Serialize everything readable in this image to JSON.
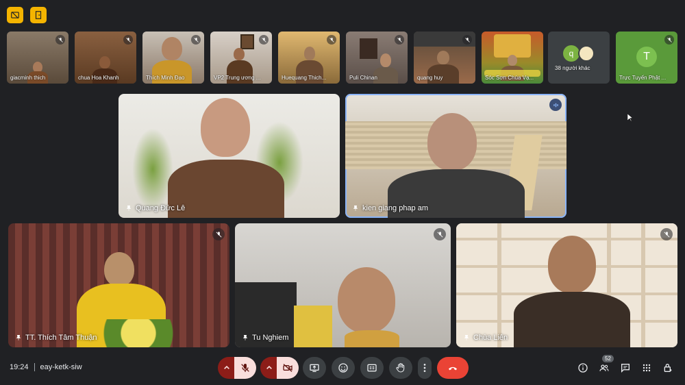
{
  "meeting": {
    "time": "19:24",
    "code": "eay-ketk-siw"
  },
  "thumbnails": [
    {
      "name": "giacminh thich",
      "bg": "#6b5a48"
    },
    {
      "name": "chua Hoa Khanh",
      "bg": "#7a4a2c"
    },
    {
      "name": "Thích Minh Đạo",
      "bg": "#8c7a6a"
    },
    {
      "name": "VP2 Trung ương ...",
      "bg": "#b4aaa0"
    },
    {
      "name": "Huequang Thich...",
      "bg": "#c49a5c"
    },
    {
      "name": "Puli Chinan",
      "bg": "#7a6c66"
    },
    {
      "name": "quang huy",
      "bg": "#9a6a4a"
    },
    {
      "name": "Sóc Sơn Chùa Vạ...",
      "bg": "#9a8a2a"
    }
  ],
  "others": {
    "label": "38 người khác",
    "initial": "q"
  },
  "livestream": {
    "name": "Trực Tuyến Phật ...",
    "initial": "T",
    "bg": "#5a9a3a"
  },
  "tiles": [
    {
      "name": "Quang Đức Lê"
    },
    {
      "name": "kien giang phap am"
    },
    {
      "name": "TT. Thích Tâm Thuận"
    },
    {
      "name": "Tu Nghiem"
    },
    {
      "name": "Chùa Liên"
    }
  ],
  "participants_count": "52",
  "colors": {
    "accent": "#8ab4f8",
    "end_call": "#ea4335",
    "muted_bg": "#f9dedc",
    "top_button": "#f4b400"
  }
}
